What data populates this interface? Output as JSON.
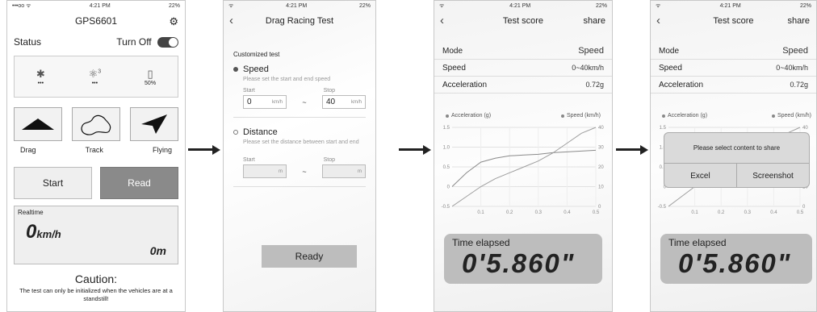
{
  "status_bar": {
    "carrier": "•••oo ᯤ",
    "time": "4:21 PM",
    "battery": "22%"
  },
  "panel1": {
    "title": "GPS6601",
    "status_label": "Status",
    "turn_off_label": "Turn Off",
    "icons": [
      {
        "icon": "bluetooth-icon",
        "glyph": "✱",
        "sub": "•••"
      },
      {
        "icon": "satellite-icon",
        "glyph": "⚛",
        "sup": "3",
        "sub": "•••"
      },
      {
        "icon": "battery-icon",
        "glyph": "▯",
        "sub": "50%"
      }
    ],
    "modes": [
      "Drag",
      "Track",
      "Flying"
    ],
    "start_label": "Start",
    "read_label": "Read",
    "realtime_label": "Realtime",
    "speed_value": "0",
    "speed_unit": "km/h",
    "distance_value": "0m",
    "caution_title": "Caution:",
    "caution_text": "The test can only be initialized when the vehicles are at a standstill!"
  },
  "panel2": {
    "title": "Drag Racing Test",
    "customized": "Customized test",
    "speed_option": "Speed",
    "speed_hint": "Please set the start and end speed",
    "start_label": "Start",
    "stop_label": "Stop",
    "start_value": "0",
    "stop_value": "40",
    "speed_unit": "km/h",
    "tilde": "~",
    "distance_option": "Distance",
    "distance_hint": "Please set the distance between start and end",
    "distance_unit": "m",
    "ready_label": "Ready"
  },
  "score": {
    "title": "Test score",
    "share": "share",
    "rows": [
      {
        "label": "Mode",
        "value": "Speed"
      },
      {
        "label": "Speed",
        "value": "0~40km/h"
      },
      {
        "label": "Acceleration",
        "value": "0.72g"
      }
    ],
    "time_label": "Time elapsed",
    "time_value": "0'5.860\""
  },
  "popup": {
    "title": "Please select content to share",
    "excel": "Excel",
    "screenshot": "Screenshot"
  },
  "chart_data": {
    "type": "line",
    "legend": [
      "Acceleration  (g)",
      "Speed  (km/h)"
    ],
    "x_ticks": [
      "0.1",
      "0.2",
      "0.3",
      "0.4",
      "0.5"
    ],
    "y_left_ticks": [
      "1.5",
      "1.0",
      "0.5",
      "0",
      "-0.5"
    ],
    "y_right_ticks": [
      "40",
      "30",
      "20",
      "10",
      "0"
    ],
    "x": [
      0,
      0.05,
      0.1,
      0.15,
      0.2,
      0.25,
      0.3,
      0.35,
      0.4,
      0.45,
      0.5
    ],
    "series": [
      {
        "name": "Acceleration  (g)",
        "axis": "left",
        "values": [
          0,
          0.35,
          0.62,
          0.72,
          0.78,
          0.8,
          0.82,
          0.86,
          0.88,
          0.9,
          0.92
        ]
      },
      {
        "name": "Speed  (km/h)",
        "axis": "right",
        "values": [
          0,
          5,
          10,
          14,
          17,
          20,
          23,
          27,
          32,
          37,
          40
        ]
      }
    ],
    "xlim": [
      0,
      0.5
    ],
    "ylim_left": [
      -0.5,
      1.5
    ],
    "ylim_right": [
      0,
      40
    ]
  }
}
